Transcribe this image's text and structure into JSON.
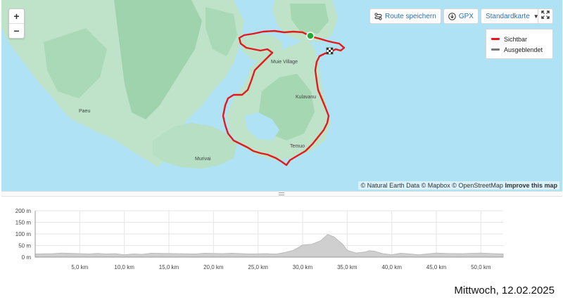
{
  "map": {
    "zoom_in": "+",
    "zoom_out": "−",
    "places": [
      "Muie Village",
      "Kulavanu",
      "Paeu",
      "Temuo",
      "Murivai"
    ],
    "buttons": {
      "save_route": "Route speichern",
      "gpx": "GPX",
      "map_style": "Standardkarte"
    },
    "legend": [
      {
        "label": "Sichtbar",
        "color": "#e31a1c"
      },
      {
        "label": "Ausgeblendet",
        "color": "#777777"
      }
    ],
    "attribution": "© Natural Earth Data © Mapbox © OpenStreetMap",
    "attribution_link": "Improve this map",
    "colors": {
      "water": "#aee2f4",
      "land": "#bfe3c9",
      "forest": "#9fd3ae",
      "route": "#e31a1c",
      "start": "#22aa33"
    },
    "icons": [
      "plus-icon",
      "minus-icon",
      "route-icon",
      "download-icon",
      "caret-down-icon",
      "fullscreen-icon",
      "finish-flag-icon"
    ]
  },
  "elevation": {
    "y_ticks": [
      "200 m",
      "150 m",
      "100 m",
      "50 m",
      "0 m"
    ],
    "x_ticks": [
      "5,0 km",
      "10,0 km",
      "15,0 km",
      "20,0 km",
      "25,0 km",
      "30,0 km",
      "35,0 km",
      "40,0 km",
      "45,0 km",
      "50,0 km"
    ],
    "y_range_m": [
      0,
      200
    ],
    "x_range_km": [
      0,
      52.5
    ],
    "profile": [
      [
        0,
        14
      ],
      [
        2,
        15
      ],
      [
        3,
        18
      ],
      [
        4,
        16
      ],
      [
        6,
        14
      ],
      [
        7,
        16
      ],
      [
        8,
        14
      ],
      [
        9,
        15
      ],
      [
        10,
        10
      ],
      [
        11,
        14
      ],
      [
        12,
        12
      ],
      [
        13,
        17
      ],
      [
        14,
        16
      ],
      [
        16,
        15
      ],
      [
        18,
        14
      ],
      [
        19,
        17
      ],
      [
        21,
        15
      ],
      [
        22,
        17
      ],
      [
        24,
        14
      ],
      [
        26,
        15
      ],
      [
        27,
        13
      ],
      [
        28,
        20
      ],
      [
        29,
        30
      ],
      [
        30,
        52
      ],
      [
        31,
        55
      ],
      [
        32,
        70
      ],
      [
        32.8,
        98
      ],
      [
        33.5,
        88
      ],
      [
        34.5,
        55
      ],
      [
        35,
        30
      ],
      [
        36,
        18
      ],
      [
        37,
        22
      ],
      [
        37.5,
        28
      ],
      [
        38,
        26
      ],
      [
        39,
        15
      ],
      [
        40,
        10
      ],
      [
        41,
        17
      ],
      [
        42,
        14
      ],
      [
        43,
        10
      ],
      [
        44,
        14
      ],
      [
        45,
        18
      ],
      [
        46,
        16
      ],
      [
        48,
        15
      ],
      [
        50,
        18
      ],
      [
        51.5,
        15
      ],
      [
        52.5,
        14
      ]
    ]
  },
  "footer": {
    "date": "Mittwoch, 12.02.2025"
  }
}
